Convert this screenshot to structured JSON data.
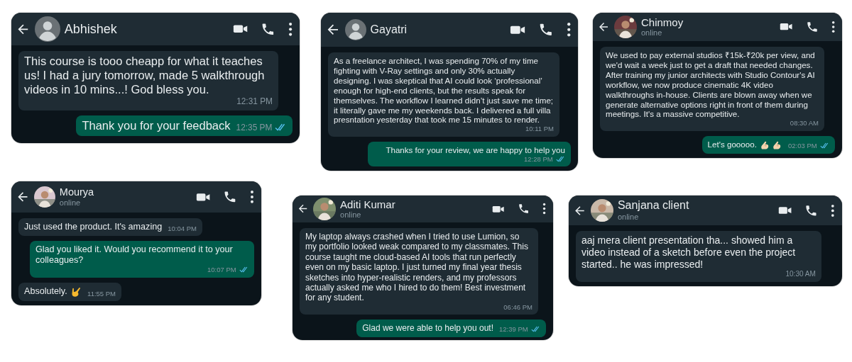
{
  "chats": [
    {
      "contact": {
        "name": "Abhishek",
        "avatar": {
          "kind": "default"
        }
      },
      "messages": [
        {
          "kind": "received",
          "text": "This course is tooo cheapp for what it teaches us! I had a jury tomorrow, made 5 walkthrough videos in 10 mins...! God bless you.",
          "time": "12:31 PM"
        },
        {
          "kind": "sent",
          "text": "Thank you for your feedback",
          "time": "12:35 PM",
          "read": true
        }
      ]
    },
    {
      "contact": {
        "name": "Gayatri",
        "avatar": {
          "kind": "default"
        }
      },
      "messages": [
        {
          "kind": "received",
          "text": "As a freelance architect, I was spending 70% of my time fighting with V-Ray settings and only 30% actually designing. I was skeptical that AI could look ‘professional’ enough for high-end clients, but the results speak for themselves. The workflow I learned didn’t just save me time; it literally gave me my weekends back. I delivered a full villa presntation yesterday that took me 15 minutes to render.",
          "time": "10:11 PM"
        },
        {
          "kind": "sent",
          "text": "Thanks for your review, we are happy to help you",
          "time": "12:28 PM",
          "read": true
        }
      ]
    },
    {
      "contact": {
        "name": "Chinmoy",
        "status": "online"
      },
      "messages": [
        {
          "kind": "received",
          "text": "We used to pay external studios ₹15k-₹20k per view, and we'd wait a week just to get a draft that needed changes. After training my junior architects with Studio Contour's AI workflow, we now produce cinematic 4K video walkthroughs in-house. Clients are blown away when we generate alternative options right in front of them during meetings. It's a massive competitive.",
          "time": "08:30 AM"
        },
        {
          "kind": "sent",
          "text": "Let's gooooo.",
          "emojis": [
            {
              "kind": "pinch"
            },
            {
              "kind": "pinch"
            }
          ],
          "time": "02:03 PM",
          "read": true
        }
      ]
    },
    {
      "contact": {
        "name": "Mourya",
        "status": "online"
      },
      "messages": [
        {
          "kind": "received",
          "text": "Just used the product. It's amazing",
          "time": "10:04 PM"
        },
        {
          "kind": "sent",
          "text": "Glad you liked it. Would you recommend it to your colleagues?",
          "time": "10:07 PM",
          "read": true
        },
        {
          "kind": "received",
          "text": "Absolutely.",
          "emojis": [
            {
              "kind": "horns"
            }
          ],
          "time": "11:55 PM"
        }
      ]
    },
    {
      "contact": {
        "name": "Aditi Kumar",
        "status": "online"
      },
      "messages": [
        {
          "kind": "received",
          "text": "My laptop always crashed when I tried to use Lumion, so my portfolio looked weak compared to my classmates. This course taught me cloud-based AI tools that run perfectly even on my basic laptop. I just turned my final year thesis sketches into hyper-realistic renders, and my professors actually asked me who I hired to do them! Best investment for any student.",
          "time": "06:46 PM"
        },
        {
          "kind": "sent",
          "text": "Glad we were able to help you out!",
          "time": "12:39 PM",
          "read": true
        }
      ]
    },
    {
      "contact": {
        "name": "Sanjana client",
        "status": "online"
      },
      "messages": [
        {
          "kind": "received",
          "text": "aaj mera client presentation tha... showed him a video instead of a sketch before even the project started.. he was impressed!",
          "time": "10:30 AM"
        }
      ]
    }
  ]
}
